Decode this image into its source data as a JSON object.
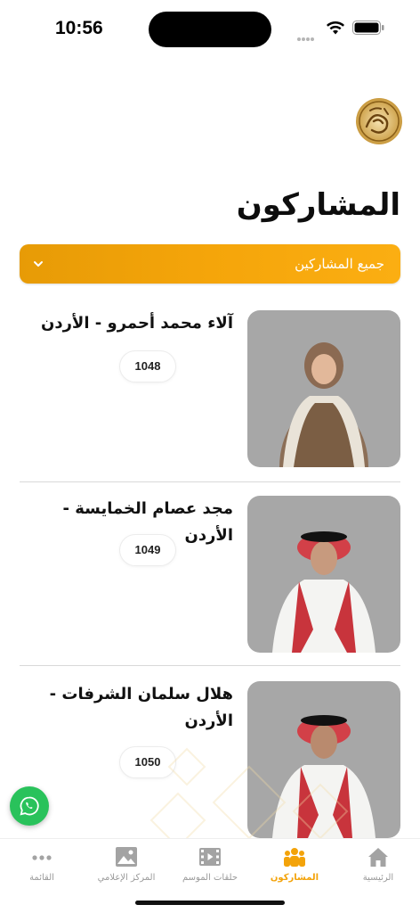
{
  "status_bar": {
    "time": "10:56"
  },
  "header": {
    "title": "المشاركون"
  },
  "filter": {
    "label": "جميع المشاركين"
  },
  "participants": [
    {
      "name": "آلاء محمد أحمرو - الأردن",
      "number": "1048"
    },
    {
      "name": "مجد عصام الخمايسة - الأردن",
      "number": "1049"
    },
    {
      "name": "هلال سلمان الشرفات - الأردن",
      "number": "1050"
    }
  ],
  "tabs": [
    {
      "label": "الرئيسية",
      "icon": "home-icon"
    },
    {
      "label": "المشاركون",
      "icon": "participants-icon",
      "active": true
    },
    {
      "label": "حلقات الموسم",
      "icon": "video-icon"
    },
    {
      "label": "المركز الإعلامي",
      "icon": "image-icon"
    },
    {
      "label": "القائمة",
      "icon": "more-icon"
    }
  ],
  "colors": {
    "accent": "#F5A50A",
    "whatsapp": "#29C25B",
    "photo_bg": "#A7A7A7"
  }
}
